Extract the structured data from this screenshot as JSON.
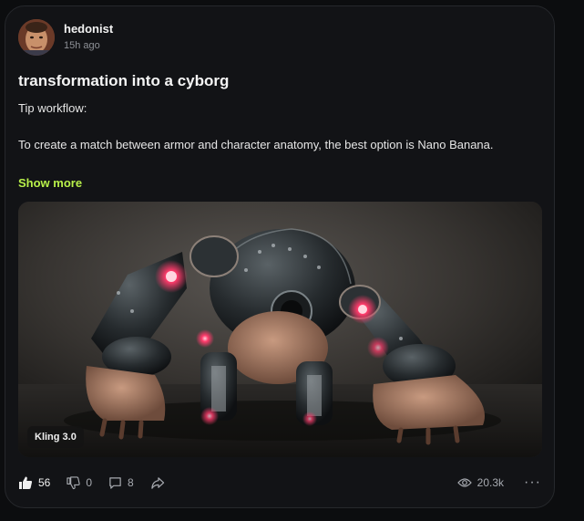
{
  "post": {
    "author": {
      "username": "hedonist",
      "timestamp": "15h ago"
    },
    "title": "transformation into a cyborg",
    "body_lines": [
      "Tip workflow:",
      "To create a match between armor and character anatomy, the best option is Nano Banana."
    ],
    "show_more_label": "Show more",
    "media": {
      "model_badge": "Kling 3.0"
    },
    "stats": {
      "likes": "56",
      "dislikes": "0",
      "comments": "8",
      "views": "20.3k"
    },
    "more_label": "···"
  },
  "colors": {
    "accent": "#b8f04a",
    "background": "#0c0d0f",
    "card": "#121316",
    "muted_text": "#a7aab0",
    "glow": "#ff3b6b"
  },
  "icons": [
    "thumbs-up-icon",
    "thumbs-down-icon",
    "comment-icon",
    "share-icon",
    "eye-icon",
    "more-icon"
  ]
}
